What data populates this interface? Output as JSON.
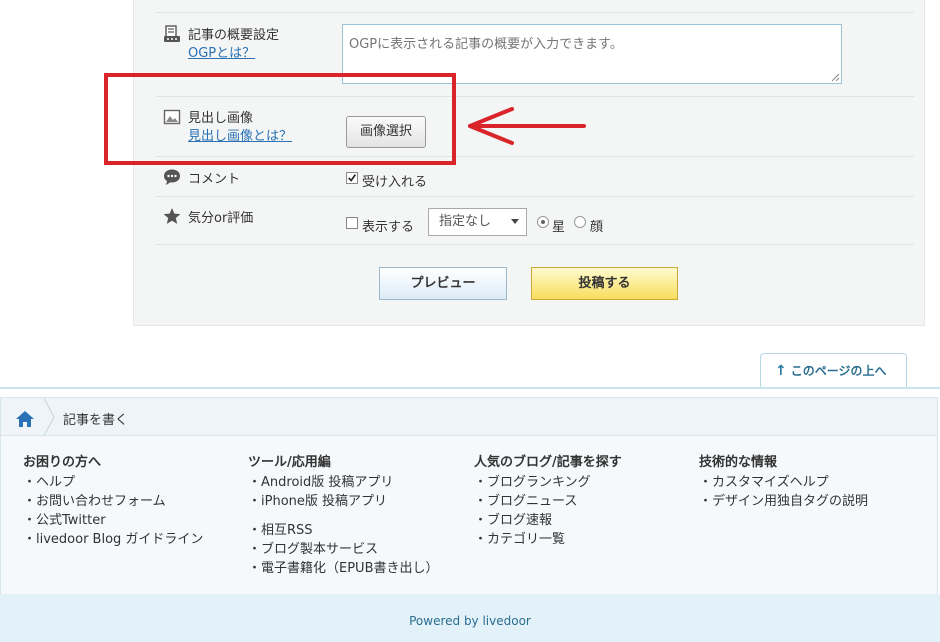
{
  "form": {
    "ogp": {
      "label": "記事の概要設定",
      "help_link": "OGPとは？",
      "placeholder": "OGPに表示される記事の概要が入力できます。"
    },
    "headline_image": {
      "label": "見出し画像",
      "help_link": "見出し画像とは？",
      "button": "画像選択"
    },
    "comment": {
      "label": "コメント",
      "checkbox_label": "受け入れる",
      "checked": true
    },
    "mood": {
      "label": "気分or評価",
      "checkbox_label": "表示する",
      "select_value": "指定なし",
      "radio_star": "星",
      "radio_face": "顔"
    },
    "preview_button": "プレビュー",
    "post_button": "投稿する"
  },
  "to_top": "このページの上へ",
  "footer": {
    "breadcrumb": "記事を書く",
    "columns": [
      {
        "title": "お困りの方へ",
        "groups": [
          [
            "・ヘルプ",
            "・お問い合わせフォーム",
            "・公式Twitter",
            "・livedoor Blog ガイドライン"
          ]
        ]
      },
      {
        "title": "ツール/応用編",
        "groups": [
          [
            "・Android版 投稿アプリ",
            "・iPhone版 投稿アプリ"
          ],
          [
            "・相互RSS",
            "・ブログ製本サービス",
            "・電子書籍化（EPUB書き出し）"
          ]
        ]
      },
      {
        "title": "人気のブログ/記事を探す",
        "groups": [
          [
            "・ブログランキング",
            "・ブログニュース",
            "・ブログ速報",
            "・カテゴリ一覧"
          ]
        ]
      },
      {
        "title": "技術的な情報",
        "groups": [
          [
            "・カスタマイズヘルプ",
            "・デザイン用独自タグの説明"
          ]
        ]
      }
    ],
    "powered_by": "Powered by livedoor"
  },
  "colors": {
    "annotation_red": "#d9252a",
    "link_blue": "#2a72b5",
    "post_yellow": "#f8dd5c"
  }
}
